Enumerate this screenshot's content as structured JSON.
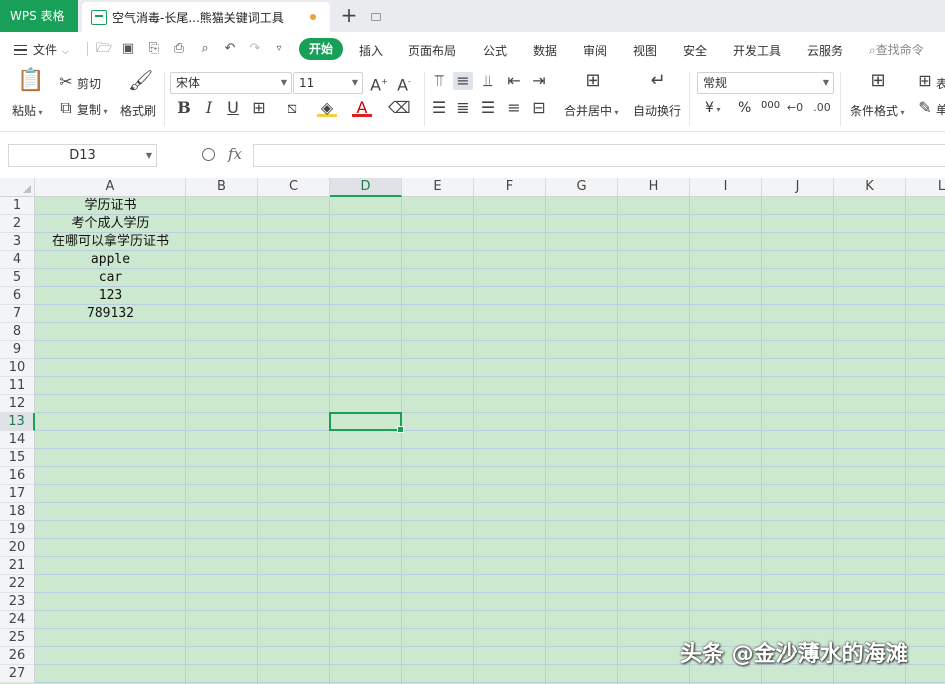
{
  "tabbar": {
    "app_name": "WPS 表格",
    "doc_title": "空气消毒-长尾...熊猫关键词工具",
    "new_tab_icon": "plus-icon"
  },
  "menubar": {
    "file_label": "文件",
    "tabs": [
      {
        "label": "开始",
        "active": true
      },
      {
        "label": "插入"
      },
      {
        "label": "页面布局"
      },
      {
        "label": "公式"
      },
      {
        "label": "数据"
      },
      {
        "label": "审阅"
      },
      {
        "label": "视图"
      },
      {
        "label": "安全"
      },
      {
        "label": "开发工具"
      },
      {
        "label": "云服务"
      }
    ],
    "search_label": "查找命令"
  },
  "ribbon": {
    "paste": "粘贴",
    "cut": "剪切",
    "copy": "复制",
    "format_painter": "格式刷",
    "font_name": "宋体",
    "font_size": "11",
    "merge_center": "合并居中",
    "wrap_text": "自动换行",
    "number_format": "常规",
    "conditional_format": "条件格式",
    "table_style_partial": "表",
    "partial_next": "单",
    "currency_symbol": "¥",
    "percent_symbol": "%",
    "thousands_symbol": "000"
  },
  "formula_bar": {
    "name_box": "D13",
    "fx": "fx",
    "value": ""
  },
  "sheet": {
    "columns": [
      "A",
      "B",
      "C",
      "D",
      "E",
      "F",
      "G",
      "H",
      "I",
      "J",
      "K",
      "L"
    ],
    "rows": [
      "1",
      "2",
      "3",
      "4",
      "5",
      "6",
      "7",
      "8",
      "9",
      "10",
      "11",
      "12",
      "13",
      "14",
      "15",
      "16",
      "17",
      "18",
      "19",
      "20",
      "21",
      "22",
      "23",
      "24",
      "25",
      "26",
      "27"
    ],
    "active_cell": "D13",
    "column_a_values": [
      "学历证书",
      "考个成人学历",
      "在哪可以拿学历证书",
      "apple",
      "car",
      "123",
      "789132"
    ],
    "cell_background": "#cce8cf",
    "accent": "#18a058"
  },
  "watermark": "头条 @金沙薄水的海滩"
}
